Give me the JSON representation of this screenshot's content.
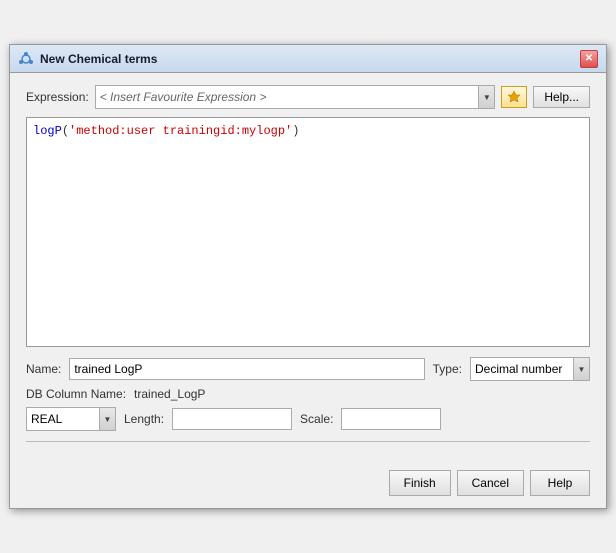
{
  "window": {
    "title": "New Chemical terms",
    "title_icon": "⚗",
    "close_label": "✕"
  },
  "expression": {
    "label": "Expression:",
    "placeholder": "< Insert Favourite Expression >",
    "star_icon": "✦",
    "help_label": "Help..."
  },
  "code": {
    "line": "logP(",
    "string": "'method:user trainingid:mylogp'",
    "closing": ")"
  },
  "name_field": {
    "label": "Name:",
    "value": "trained LogP",
    "type_label": "Type:",
    "type_value": "Decimal number"
  },
  "db_field": {
    "label": "DB Column Name:",
    "value": "trained_LogP"
  },
  "data_type": {
    "value": "REAL",
    "length_label": "Length:",
    "length_value": "",
    "scale_label": "Scale:",
    "scale_value": ""
  },
  "buttons": {
    "finish": "Finish",
    "cancel": "Cancel",
    "help": "Help"
  }
}
